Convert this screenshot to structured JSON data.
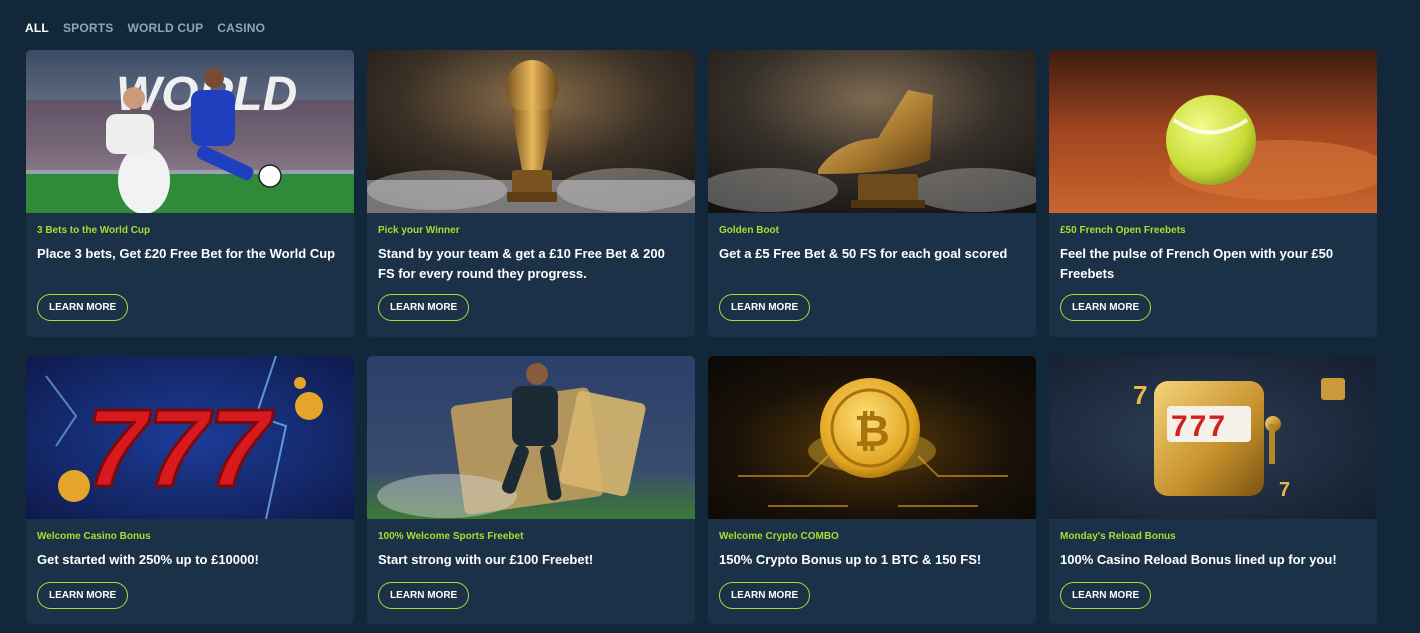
{
  "tabs": [
    "ALL",
    "SPORTS",
    "WORLD CUP",
    "CASINO"
  ],
  "cards": [
    {
      "kicker": "3 Bets to the World Cup",
      "title": "Place 3 bets, Get £20 Free Bet for the World Cup",
      "button": "LEARN MORE",
      "image": "world-cup-players-image",
      "banner_text": "WORLD"
    },
    {
      "kicker": "Pick your Winner",
      "title": "Stand by your team & get a £10 Free Bet & 200 FS for every round they progress.",
      "button": "LEARN MORE",
      "image": "trophy-image"
    },
    {
      "kicker": "Golden Boot",
      "title": "Get a £5 Free Bet & 50 FS for each goal scored",
      "button": "LEARN MORE",
      "image": "golden-boot-image"
    },
    {
      "kicker": "£50 French Open Freebets",
      "title": "Feel the pulse of French Open with your £50 Freebets",
      "button": "LEARN MORE",
      "image": "tennis-ball-image"
    },
    {
      "kicker": "Welcome Casino Bonus",
      "title": "Get started with 250% up to £10000!",
      "button": "LEARN MORE",
      "image": "lucky-777-image",
      "banner_text": "777"
    },
    {
      "kicker": "100% Welcome Sports Freebet",
      "title": "Start strong with our £100 Freebet!",
      "button": "LEARN MORE",
      "image": "football-player-image"
    },
    {
      "kicker": "Welcome Crypto COMBO",
      "title": "150% Crypto Bonus up to 1 BTC & 150 FS!",
      "button": "LEARN MORE",
      "image": "bitcoin-coin-image"
    },
    {
      "kicker": "Monday's Reload Bonus",
      "title": "100% Casino Reload Bonus lined up for you!",
      "button": "LEARN MORE",
      "image": "slot-machine-image",
      "banner_text": "777"
    }
  ],
  "colors": {
    "accent": "#a4e02f",
    "background": "#12283a",
    "card": "#1a3147"
  }
}
